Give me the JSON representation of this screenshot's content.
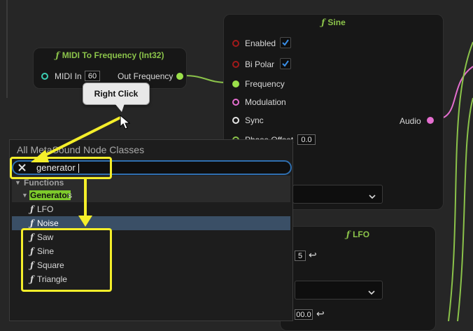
{
  "midi_node": {
    "title": "MIDI To Frequency (Int32)",
    "input_label": "MIDI In",
    "input_value": "60",
    "output_label": "Out Frequency"
  },
  "sine_node": {
    "title": "Sine",
    "pins": {
      "enabled": "Enabled",
      "bipolar": "Bi Polar",
      "frequency": "Frequency",
      "modulation": "Modulation",
      "sync": "Sync",
      "phase_offset": "Phase Offset",
      "audio": "Audio"
    },
    "phase_offset_value": "0.0",
    "enabled_checked": true,
    "bipolar_checked": true
  },
  "lfo_node": {
    "title": "LFO",
    "value_1": "5",
    "value_2": "00.0"
  },
  "tooltip": {
    "text": "Right Click"
  },
  "menu": {
    "title": "All MetaSound Node Classes",
    "search_value": "generator",
    "category": "Functions",
    "subcategory_match": "Generator",
    "subcategory_rest": "s",
    "items": [
      "LFO",
      "Noise",
      "Saw",
      "Sine",
      "Square",
      "Triangle"
    ]
  },
  "colors": {
    "accent_green": "#8bc34a",
    "annotation_yellow": "#f4ee2a",
    "search_border": "#2f6fb0",
    "selection_row": "#3a4f66"
  }
}
